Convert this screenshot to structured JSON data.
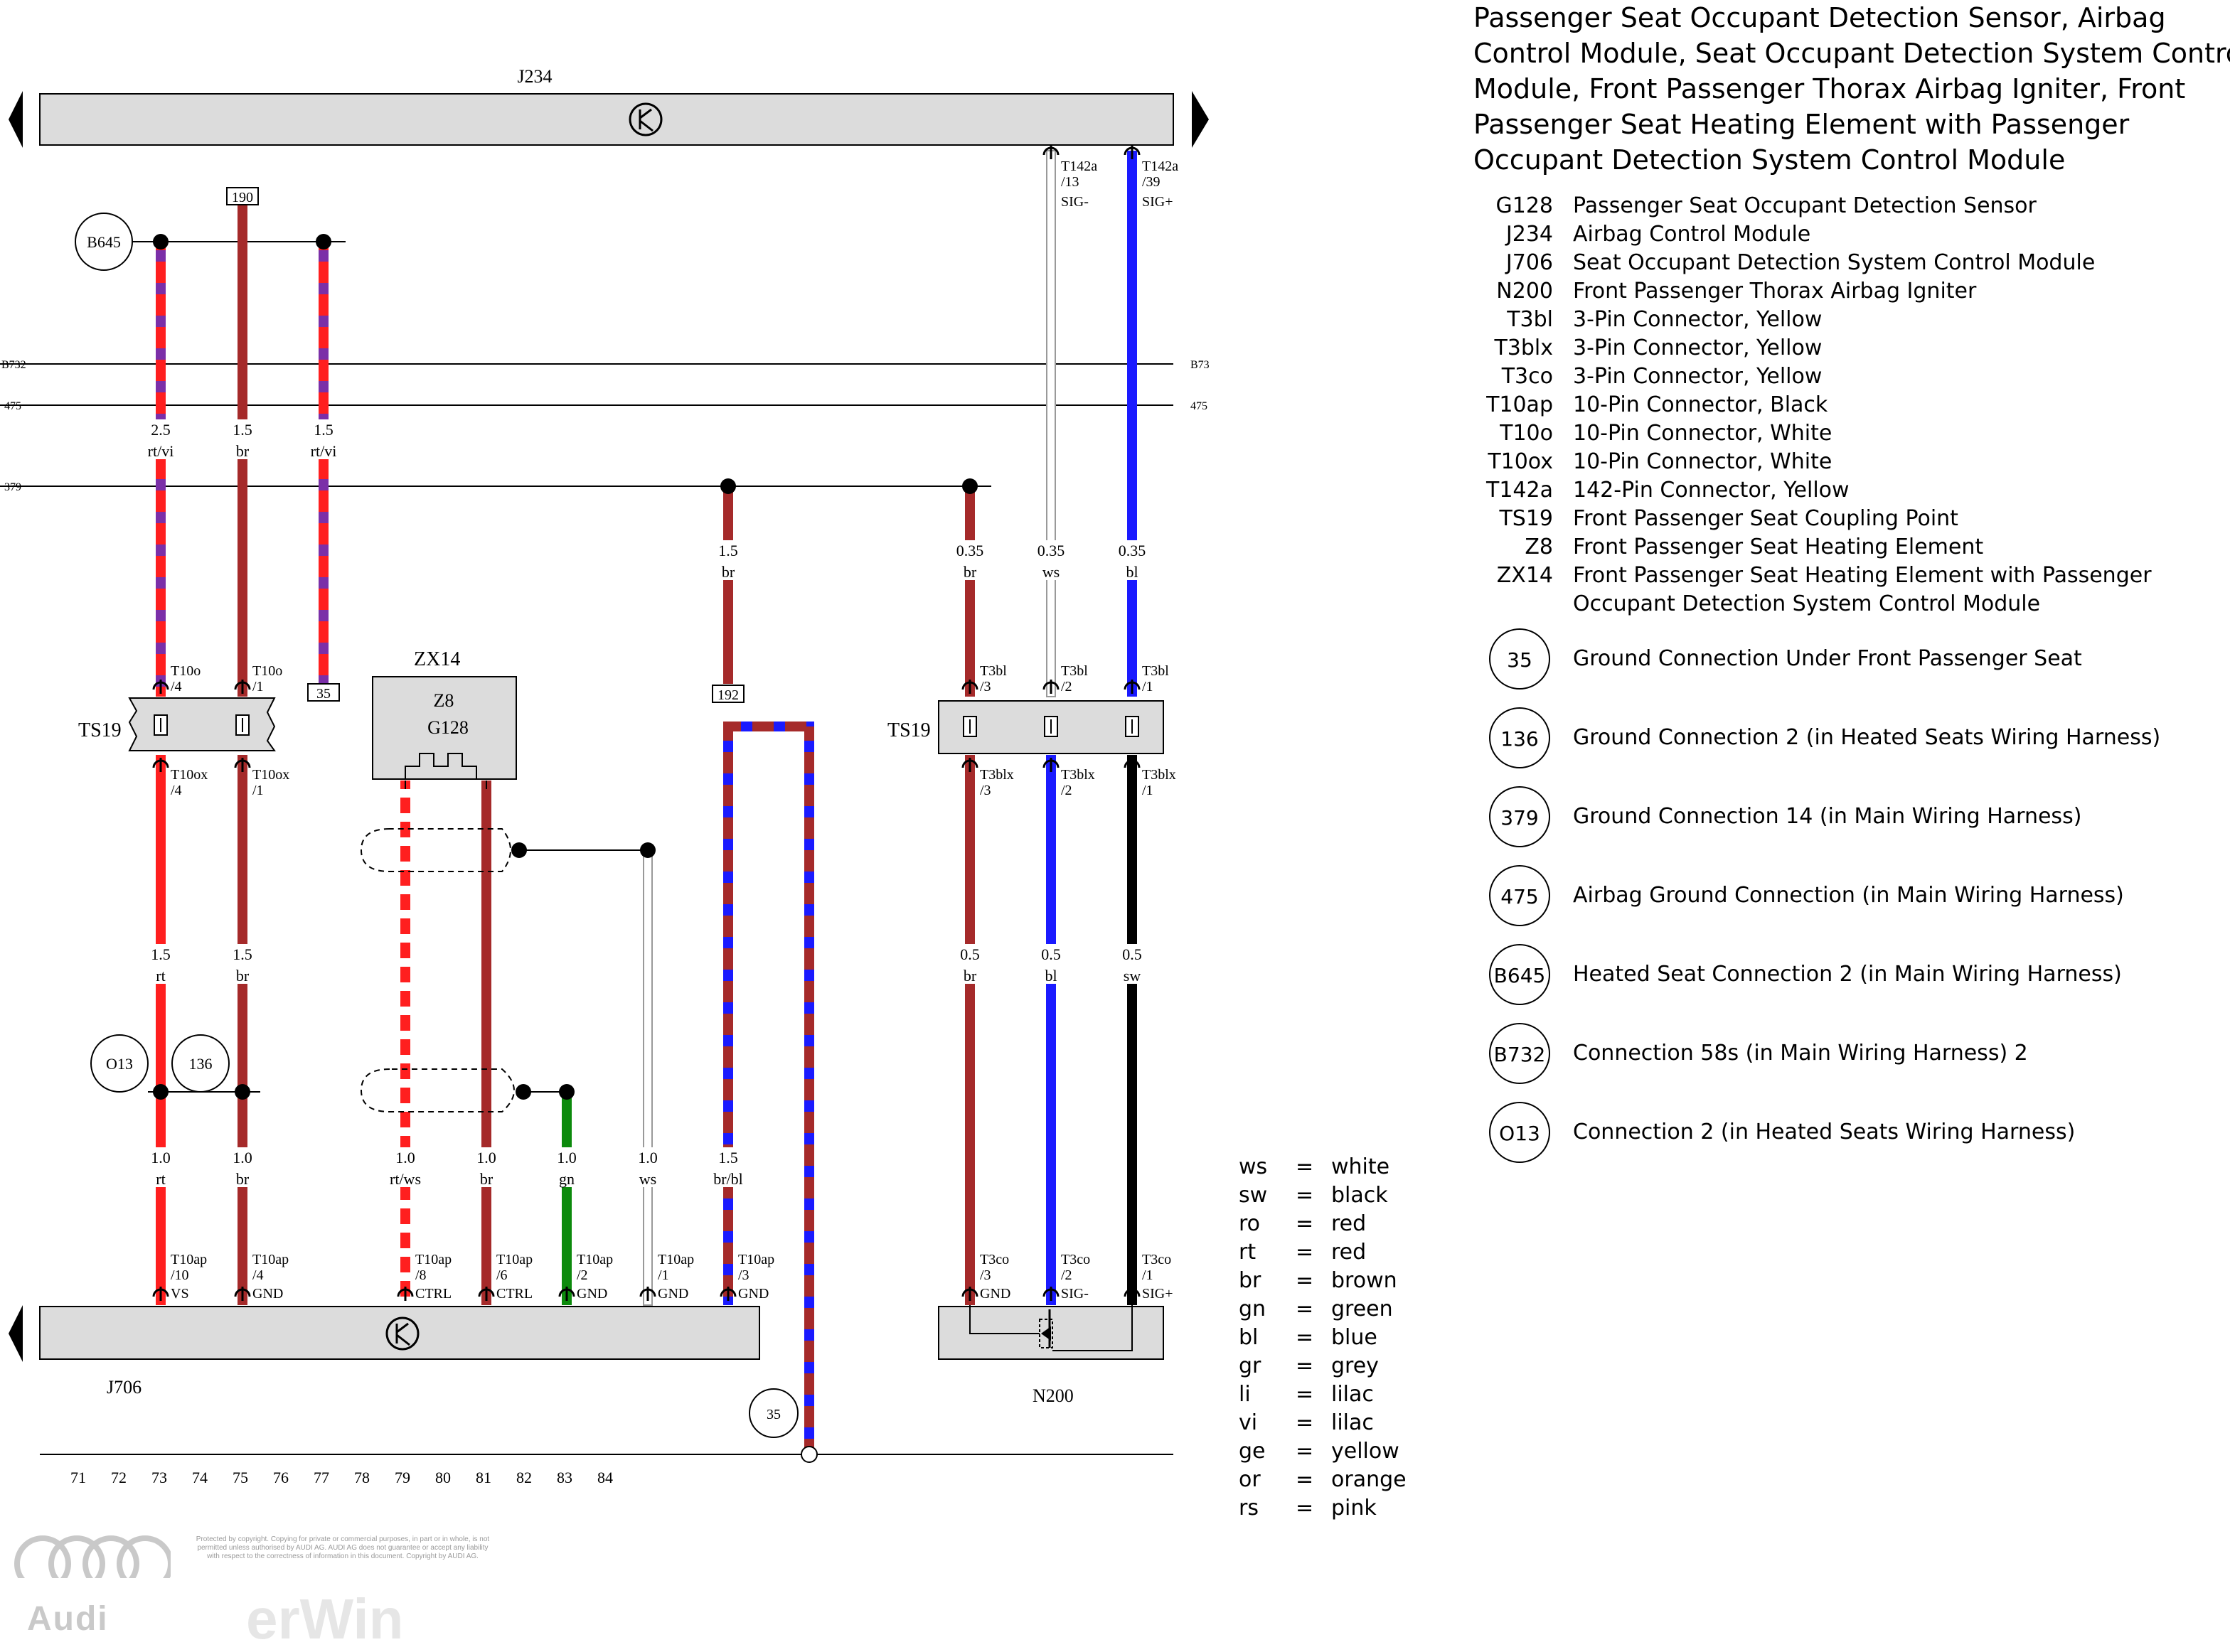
{
  "title_lines": [
    "Passenger Seat Occupant Detection Sensor, Airbag",
    "Control Module, Seat Occupant Detection System Control",
    "Module, Front Passenger Thorax Airbag Igniter, Front",
    "Passenger Seat Heating Element with Passenger",
    "Occupant Detection System Control Module"
  ],
  "legend": [
    {
      "code": "G128",
      "desc": "Passenger Seat Occupant Detection Sensor"
    },
    {
      "code": "J234",
      "desc": "Airbag Control Module"
    },
    {
      "code": "J706",
      "desc": "Seat Occupant Detection System Control Module"
    },
    {
      "code": "N200",
      "desc": "Front Passenger Thorax Airbag Igniter"
    },
    {
      "code": "T3bl",
      "desc": "3-Pin Connector, Yellow"
    },
    {
      "code": "T3blx",
      "desc": "3-Pin Connector, Yellow"
    },
    {
      "code": "T3co",
      "desc": "3-Pin Connector, Yellow"
    },
    {
      "code": "T10ap",
      "desc": "10-Pin Connector, Black"
    },
    {
      "code": "T10o",
      "desc": "10-Pin Connector, White"
    },
    {
      "code": "T10ox",
      "desc": "10-Pin Connector, White"
    },
    {
      "code": "T142a",
      "desc": "142-Pin Connector, Yellow"
    },
    {
      "code": "TS19",
      "desc": "Front Passenger Seat Coupling Point"
    },
    {
      "code": "Z8",
      "desc": "Front Passenger Seat Heating Element"
    },
    {
      "code": "ZX14",
      "desc": "Front Passenger Seat Heating Element with Passenger"
    },
    {
      "code": "",
      "desc": "Occupant Detection System Control Module"
    }
  ],
  "ground_legend": [
    {
      "code": "35",
      "desc": "Ground Connection Under Front Passenger Seat"
    },
    {
      "code": "136",
      "desc": "Ground Connection 2 (in Heated Seats Wiring Harness)"
    },
    {
      "code": "379",
      "desc": "Ground Connection 14 (in Main Wiring Harness)"
    },
    {
      "code": "475",
      "desc": "Airbag Ground Connection (in Main Wiring Harness)"
    },
    {
      "code": "B645",
      "desc": "Heated Seat Connection 2 (in Main Wiring Harness)"
    },
    {
      "code": "B732",
      "desc": "Connection 58s (in Main Wiring Harness) 2"
    },
    {
      "code": "O13",
      "desc": "Connection 2 (in Heated Seats Wiring Harness)"
    }
  ],
  "color_codes": [
    {
      "abbr": "ws",
      "eq": "=",
      "name": "white"
    },
    {
      "abbr": "sw",
      "eq": "=",
      "name": "black"
    },
    {
      "abbr": "ro",
      "eq": "=",
      "name": "red"
    },
    {
      "abbr": "rt",
      "eq": "=",
      "name": "red"
    },
    {
      "abbr": "br",
      "eq": "=",
      "name": "brown"
    },
    {
      "abbr": "gn",
      "eq": "=",
      "name": "green"
    },
    {
      "abbr": "bl",
      "eq": "=",
      "name": "blue"
    },
    {
      "abbr": "gr",
      "eq": "=",
      "name": "grey"
    },
    {
      "abbr": "li",
      "eq": "=",
      "name": "lilac"
    },
    {
      "abbr": "vi",
      "eq": "=",
      "name": "lilac"
    },
    {
      "abbr": "ge",
      "eq": "=",
      "name": "yellow"
    },
    {
      "abbr": "or",
      "eq": "=",
      "name": "orange"
    },
    {
      "abbr": "rs",
      "eq": "=",
      "name": "pink"
    }
  ],
  "wire_colors": {
    "red": "#ff1f1f",
    "brown": "#a52a2a",
    "violet": "#7b2fa8",
    "blue": "#1a1aff",
    "green": "#0c8a0c",
    "black": "#000000",
    "white": "#ffffff",
    "component_fill": "#dcdcdc"
  },
  "diagram": {
    "top_module": "J234",
    "bottom_module": "J706",
    "igniter": "N200",
    "heater_module": "ZX14",
    "heater_element": "Z8",
    "sensor": "G128",
    "coupling_left": "TS19",
    "coupling_right": "TS19",
    "track_numbers": [
      "71",
      "72",
      "73",
      "74",
      "75",
      "76",
      "77",
      "78",
      "79",
      "80",
      "81",
      "82",
      "83",
      "84"
    ],
    "bus_lines": [
      {
        "label_left": "B732",
        "label_right": "B73"
      },
      {
        "label_left": "475",
        "label_right": "475"
      },
      {
        "label_left": "379",
        "label_right": ""
      }
    ],
    "ground_circles": [
      "B645",
      "O13",
      "136",
      "35"
    ],
    "ref_boxes": [
      "190",
      "35",
      "192"
    ],
    "wire_labels_upper": [
      {
        "size": "2.5",
        "color": "rt/vi"
      },
      {
        "size": "1.5",
        "color": "br"
      },
      {
        "size": "1.5",
        "color": "rt/vi"
      },
      {
        "size": "1.5",
        "color": "br"
      },
      {
        "size": "0.35",
        "color": "br"
      },
      {
        "size": "0.35",
        "color": "ws"
      },
      {
        "size": "0.35",
        "color": "bl"
      }
    ],
    "wire_labels_middle": [
      {
        "size": "1.5",
        "color": "rt"
      },
      {
        "size": "1.5",
        "color": "br"
      },
      {
        "size": "0.5",
        "color": "br"
      },
      {
        "size": "0.5",
        "color": "bl"
      },
      {
        "size": "0.5",
        "color": "sw"
      }
    ],
    "wire_labels_lower": [
      {
        "size": "1.0",
        "color": "rt"
      },
      {
        "size": "1.0",
        "color": "br"
      },
      {
        "size": "1.0",
        "color": "rt/ws"
      },
      {
        "size": "1.0",
        "color": "br"
      },
      {
        "size": "1.0",
        "color": "gn"
      },
      {
        "size": "1.0",
        "color": "ws"
      },
      {
        "size": "1.5",
        "color": "br/bl"
      }
    ],
    "pins_top": [
      {
        "conn": "T142a",
        "pin": "/13",
        "sig": "SIG-"
      },
      {
        "conn": "T142a",
        "pin": "/39",
        "sig": "SIG+"
      }
    ],
    "pins_ts19_left_top": [
      {
        "conn": "T10o",
        "pin": "/4"
      },
      {
        "conn": "T10o",
        "pin": "/1"
      }
    ],
    "pins_ts19_left_bottom": [
      {
        "conn": "T10ox",
        "pin": "/4"
      },
      {
        "conn": "T10ox",
        "pin": "/1"
      }
    ],
    "pins_ts19_right_top": [
      {
        "conn": "T3bl",
        "pin": "/3"
      },
      {
        "conn": "T3bl",
        "pin": "/2"
      },
      {
        "conn": "T3bl",
        "pin": "/1"
      }
    ],
    "pins_ts19_right_bottom": [
      {
        "conn": "T3blx",
        "pin": "/3"
      },
      {
        "conn": "T3blx",
        "pin": "/2"
      },
      {
        "conn": "T3blx",
        "pin": "/1"
      }
    ],
    "pins_j706": [
      {
        "conn": "T10ap",
        "pin": "/10",
        "sig": "VS"
      },
      {
        "conn": "T10ap",
        "pin": "/4",
        "sig": "GND"
      },
      {
        "conn": "T10ap",
        "pin": "/8",
        "sig": "CTRL"
      },
      {
        "conn": "T10ap",
        "pin": "/6",
        "sig": "CTRL"
      },
      {
        "conn": "T10ap",
        "pin": "/2",
        "sig": "GND"
      },
      {
        "conn": "T10ap",
        "pin": "/1",
        "sig": "GND"
      },
      {
        "conn": "T10ap",
        "pin": "/3",
        "sig": "GND"
      }
    ],
    "pins_n200": [
      {
        "conn": "T3co",
        "pin": "/3",
        "sig": "GND"
      },
      {
        "conn": "T3co",
        "pin": "/2",
        "sig": "SIG-"
      },
      {
        "conn": "T3co",
        "pin": "/1",
        "sig": "SIG+"
      }
    ]
  },
  "copyright_lines": [
    "Protected by copyright. Copying for private or commercial purposes, in part or in whole, is not",
    "permitted unless authorised by AUDI AG. AUDI AG does not guarantee or accept any liability",
    "with respect to the correctness of information in this document. Copyright by AUDI AG."
  ],
  "brand": "Audi",
  "watermark": "erWin"
}
